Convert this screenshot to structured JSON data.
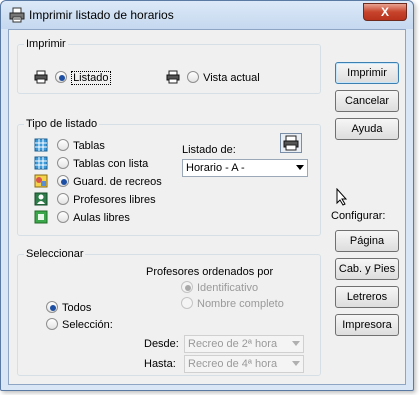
{
  "window": {
    "title": "Imprimir listado de horarios",
    "close_label": "X"
  },
  "imprimir_group": {
    "legend": "Imprimir",
    "listado_label": "Listado",
    "vista_label": "Vista actual"
  },
  "tipo_group": {
    "legend": "Tipo de listado",
    "items": [
      {
        "label": "Tablas"
      },
      {
        "label": "Tablas con lista"
      },
      {
        "label": "Guard. de recreos"
      },
      {
        "label": "Profesores libres"
      },
      {
        "label": "Aulas libres"
      }
    ],
    "listado_de_label": "Listado de:",
    "listado_de_value": "Horario - A -"
  },
  "seleccionar_group": {
    "legend": "Seleccionar",
    "todos_label": "Todos",
    "seleccion_label": "Selección:",
    "profesores_heading": "Profesores ordenados por",
    "identificativo_label": "Identificativo",
    "nombre_label": "Nombre completo",
    "desde_label": "Desde:",
    "desde_value": "Recreo de 2ª hora",
    "hasta_label": "Hasta:",
    "hasta_value": "Recreo de 4ª hora"
  },
  "buttons": {
    "imprimir": "Imprimir",
    "cancelar": "Cancelar",
    "ayuda": "Ayuda",
    "configurar_label": "Configurar:",
    "pagina": "Página",
    "cab_pies": "Cab. y Pies",
    "letreros": "Letreros",
    "impresora": "Impresora"
  }
}
